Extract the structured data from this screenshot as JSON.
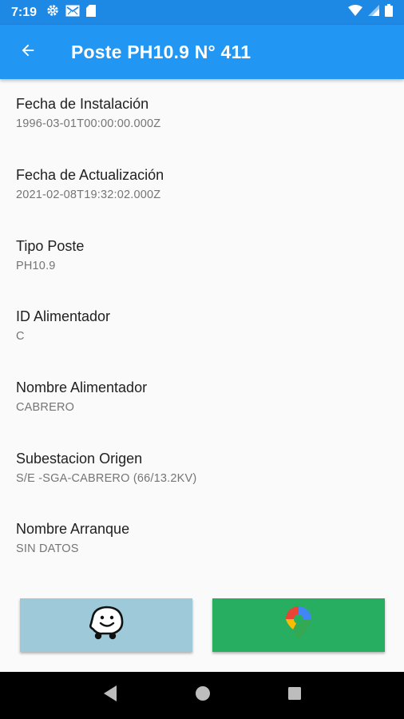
{
  "status_bar": {
    "time": "7:19",
    "icons_left": [
      "gear-icon",
      "mail-icon",
      "sd-card-icon"
    ],
    "icons_right": [
      "wifi-icon",
      "signal-icon",
      "battery-icon"
    ]
  },
  "app_bar": {
    "title": "Poste PH10.9 N° 411",
    "back_icon": "arrow-back-icon",
    "color": "#2196f3"
  },
  "fields": [
    {
      "label": "Fecha de Instalación",
      "value": "1996-03-01T00:00:00.000Z"
    },
    {
      "label": "Fecha de Actualización",
      "value": "2021-02-08T19:32:02.000Z"
    },
    {
      "label": "Tipo Poste",
      "value": "PH10.9"
    },
    {
      "label": "ID Alimentador",
      "value": "C"
    },
    {
      "label": "Nombre Alimentador",
      "value": "CABRERO"
    },
    {
      "label": "Subestacion Origen",
      "value": "S/E -SGA-CABRERO (66/13.2KV)"
    },
    {
      "label": "Nombre Arranque",
      "value": "SIN DATOS"
    }
  ],
  "actions": {
    "waze": {
      "icon": "waze-icon",
      "color": "#9dc9d9"
    },
    "maps": {
      "icon": "google-maps-icon",
      "color": "#27ae60"
    }
  },
  "nav_bar": {
    "buttons": [
      "back-triangle-icon",
      "home-circle-icon",
      "recents-square-icon"
    ]
  }
}
